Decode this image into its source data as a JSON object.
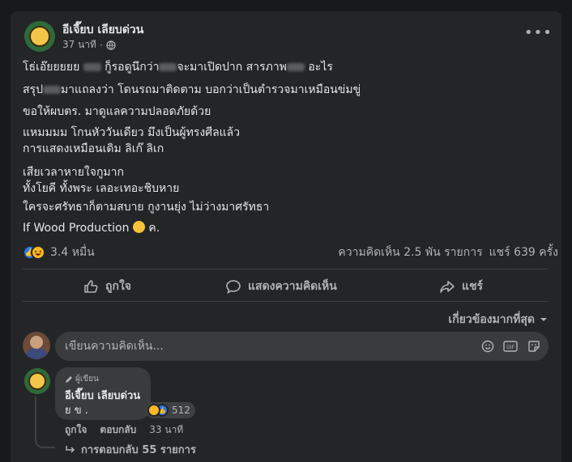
{
  "post": {
    "author": "อีเจี๊ยบ เลียบด่วน",
    "time": "37 นาที",
    "privacy_icon": "globe-icon",
    "more_label": "•••",
    "lines": [
      [
        "โธ่เอ๊ยยยยย ",
        "blur",
        " กู็รอดูนึกว่า",
        "blur",
        "จะมาเปิดปาก สารภาพ",
        "blur",
        " อะไร"
      ],
      [
        "สรุป",
        "blur",
        "มาแถลงว่า โดนรถมาติดตาม บอกว่าเป็นตำรวจมาเหมือนข่มขู่"
      ],
      [
        "ขอให้ผบตร. มาดูแลความปลอดภัยด้วย"
      ],
      [
        "แหมมมม โกนหัววันเดียว มึงเป็นผู้ทรงศีลแล้ว"
      ],
      [
        "การแสดงเหมือนเดิม ลิเก๊ ลิเก"
      ],
      [
        "เสียเวลาหายใจกูมาก"
      ],
      [
        "ทั้งโยคี ทั้งพระ เลอะเทอะชิบหาย"
      ],
      [
        "ใครจะศรัทธาก็ตามสบาย กูงานยุ่ง ไม่ว่างมาศรัทธา"
      ],
      [
        "If Wood Production ",
        "emoji",
        " ค."
      ]
    ],
    "reactions_count": "3.4 หมื่น",
    "comments_stat": "ความคิดเห็น 2.5 พัน รายการ",
    "shares_stat": "แชร์ 639 ครั้ง"
  },
  "actions": {
    "like": "ถูกใจ",
    "comment": "แสดงความคิดเห็น",
    "share": "แชร์"
  },
  "sort_label": "เกี่ยวข้องมากที่สุด",
  "comment_input": {
    "placeholder": "เขียนความคิดเห็น..."
  },
  "comment": {
    "badge": "ผู้เขียน",
    "author": "อีเจี๊ยบ เลียบด่วน",
    "text": "ย ข .",
    "reaction_count": "512",
    "like": "ถูกใจ",
    "reply": "ตอบกลับ",
    "time": "33 นาที",
    "replies": "การตอบกลับ 55 รายการ"
  },
  "colors": {
    "background": "#18191a",
    "card": "#242526",
    "like_blue": "#2078f4",
    "haha_yellow": "#f7b928"
  }
}
